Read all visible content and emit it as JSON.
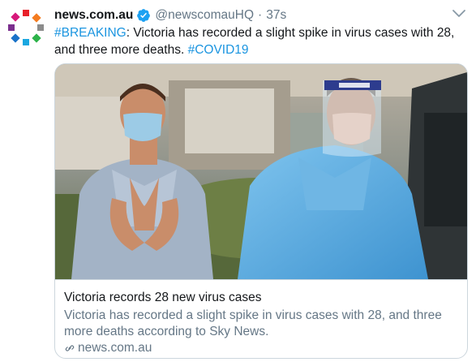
{
  "tweet": {
    "author_name": "news.com.au",
    "handle": "@newscomauHQ",
    "separator": "·",
    "time": "37s",
    "text_parts": {
      "hashtag1": "#BREAKING",
      "body": ": Victoria has recorded a slight spike in virus cases with 28, and three more deaths. ",
      "hashtag2": "#COVID19"
    }
  },
  "card": {
    "title": "Victoria records 28 new virus cases",
    "description": "Victoria has recorded a slight spike in virus cases with 28, and three more deaths according to Sky News.",
    "domain": "news.com.au",
    "image_icon": "photo-of-health-workers-in-ppe"
  },
  "icons": {
    "avatar": "news-com-au-logo-icon",
    "verified": "verified-badge-icon",
    "more": "chevron-down-icon",
    "link": "link-icon"
  },
  "colors": {
    "link": "#1b95e0",
    "secondary_text": "#657786",
    "verified": "#1da1f2",
    "border": "#ccd6dd"
  }
}
